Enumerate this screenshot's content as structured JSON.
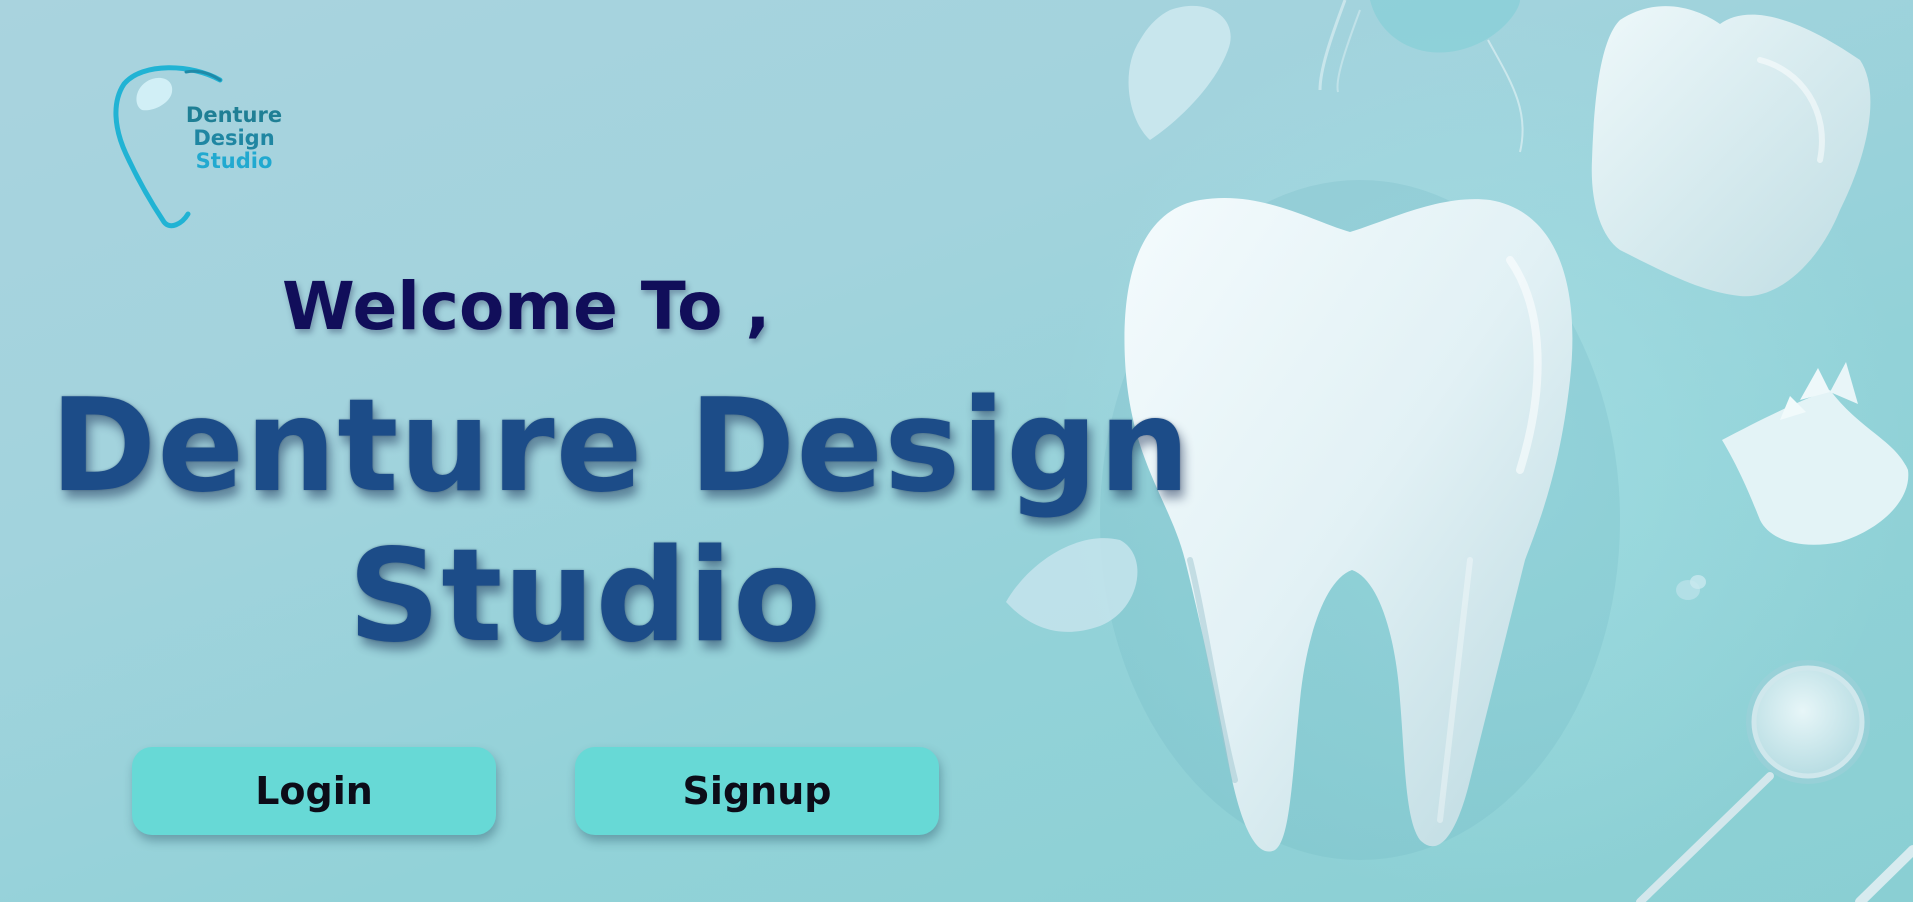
{
  "logo": {
    "line1": "Denture",
    "line2": "Design",
    "line3": "Studio"
  },
  "hero": {
    "welcome": "Welcome To ,",
    "title_line1": "Denture Design",
    "title_line2": "Studio"
  },
  "buttons": {
    "login": "Login",
    "signup": "Signup"
  },
  "icons": {
    "logo": "tooth-outline-icon",
    "hero_tooth": "molar-tooth-icon",
    "decor_tooth": "small-tooth-icon",
    "dental_mirror": "dental-mirror-icon",
    "denture": "denture-crown-icon"
  },
  "colors": {
    "background": "#a2d3dd",
    "button": "#67d9d6",
    "title": "#1c4c88",
    "welcome": "#110e5a",
    "logo_accent": "#21a9d0"
  }
}
